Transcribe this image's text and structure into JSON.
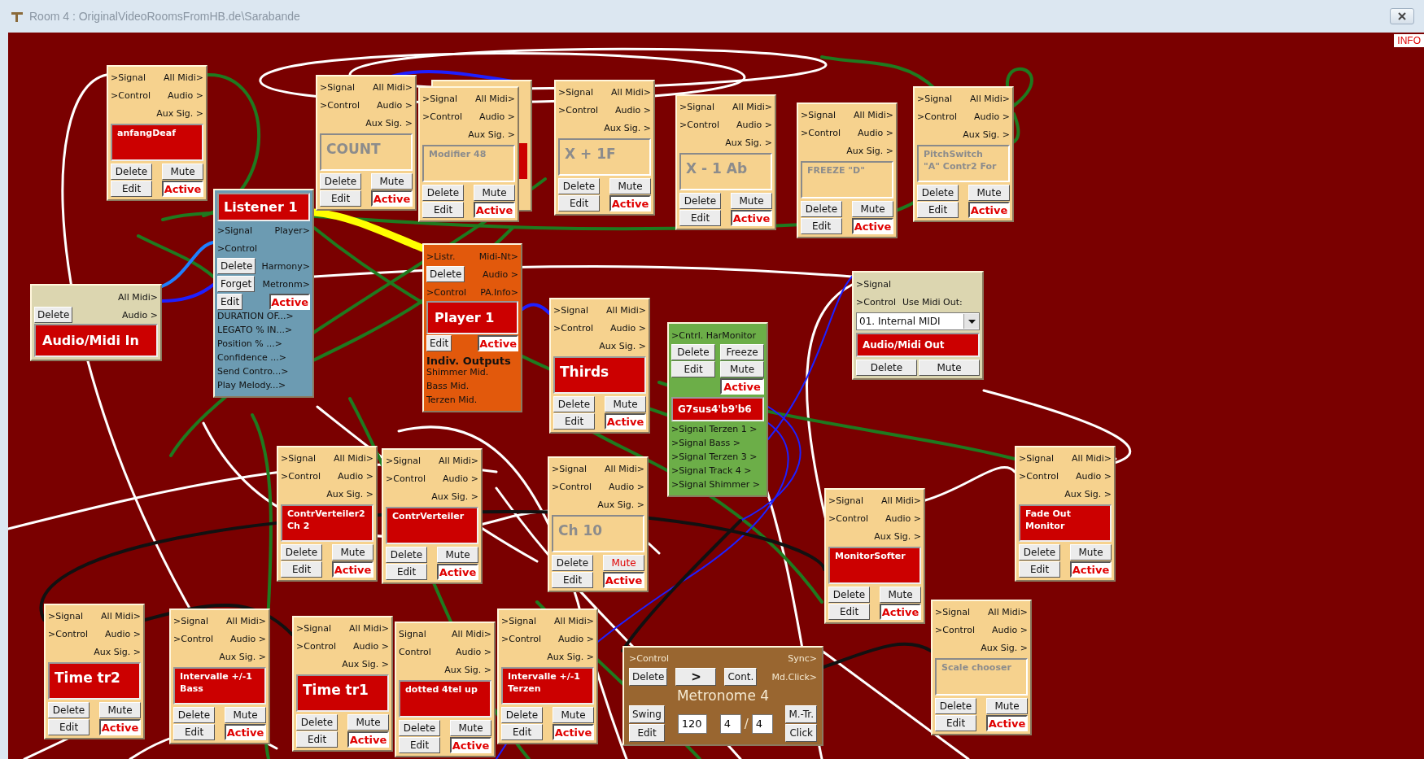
{
  "window": {
    "title": "Room 4 : OriginalVideoRoomsFromHB.de\\Sarabande",
    "info": "INFO"
  },
  "nodes": [
    {
      "kind": "module",
      "in": [
        ">Signal",
        ">Control"
      ],
      "out": [
        "All Midi>",
        "Audio >",
        "Aux Sig. >"
      ],
      "label": [
        "anfangDeaf"
      ],
      "highlighted": true,
      "large": false,
      "buttons": [
        "Delete",
        "Edit",
        "Mute"
      ],
      "status": "Active",
      "muted": false
    },
    {
      "kind": "module",
      "in": [
        ">Signal",
        ">Control"
      ],
      "out": [
        "All Midi>",
        "Audio >",
        "Aux Sig. >"
      ],
      "label": [
        "COUNT"
      ],
      "highlighted": false,
      "large": true,
      "buttons": [
        "Delete",
        "Edit",
        "Mute"
      ],
      "status": "Active",
      "muted": false
    },
    {
      "kind": "module",
      "in": [
        ">Signal",
        ">Control"
      ],
      "out": [
        "All Midi>",
        "Audio >",
        "Aux Sig. >"
      ],
      "label": [
        "Modifier 48"
      ],
      "highlighted": false,
      "large": false,
      "buttons": [
        "Delete",
        "Edit",
        "Mute"
      ],
      "status": "Active",
      "muted": false
    },
    {
      "kind": "module",
      "in": [
        ">Signal",
        ">Control"
      ],
      "out": [
        "All Midi>",
        "Audio >",
        "Aux Sig. >"
      ],
      "label": [
        "X + 1F"
      ],
      "highlighted": false,
      "large": true,
      "buttons": [
        "Delete",
        "Edit",
        "Mute"
      ],
      "status": "Active",
      "muted": false
    },
    {
      "kind": "module",
      "in": [
        ">Signal",
        ">Control"
      ],
      "out": [
        "All Midi>",
        "Audio >",
        "Aux Sig. >"
      ],
      "label": [
        "X - 1 Ab"
      ],
      "highlighted": false,
      "large": true,
      "buttons": [
        "Delete",
        "Edit",
        "Mute"
      ],
      "status": "Active",
      "muted": false
    },
    {
      "kind": "module",
      "in": [
        ">Signal",
        ">Control"
      ],
      "out": [
        "All Midi>",
        "Audio >",
        "Aux Sig. >"
      ],
      "label": [
        "FREEZE \"D\""
      ],
      "highlighted": false,
      "large": false,
      "buttons": [
        "Delete",
        "Edit",
        "Mute"
      ],
      "status": "Active",
      "muted": false
    },
    {
      "kind": "module",
      "in": [
        ">Signal",
        ">Control"
      ],
      "out": [
        "All Midi>",
        "Audio >",
        "Aux Sig. >"
      ],
      "label": [
        "PitchSwitch",
        "\"A\" Contr2 For"
      ],
      "highlighted": false,
      "large": false,
      "buttons": [
        "Delete",
        "Edit",
        "Mute"
      ],
      "status": "Active",
      "muted": false
    },
    {
      "kind": "listener",
      "title": "Listener 1",
      "in": [
        ">Signal",
        ">Control"
      ],
      "out": [
        "Player>",
        "Harmony>",
        "Metronm>"
      ],
      "buttons": [
        "Delete",
        "Forget",
        "Edit"
      ],
      "status": "Active",
      "items": [
        "DURATION OF...>",
        "LEGATO % IN...>",
        "Position % ...>",
        "Confidence ...>",
        "Send Contro...>",
        "Play Melody...>"
      ]
    },
    {
      "kind": "audio_in",
      "out": [
        "All Midi>",
        "Audio >"
      ],
      "buttons": [
        "Delete"
      ],
      "label": "Audio/Midi In"
    },
    {
      "kind": "player",
      "in": [
        ">Listr.",
        ">Control"
      ],
      "out": [
        "Midi-Nt>",
        "Audio >",
        "PA.Info>"
      ],
      "buttons": [
        "Delete",
        "Edit"
      ],
      "status": "Active",
      "label": "Player 1",
      "heading": "Indiv. Outputs",
      "items": [
        "Shimmer Mid.",
        "Bass Mid.",
        "Terzen Mid."
      ]
    },
    {
      "kind": "module",
      "in": [
        ">Signal",
        ">Control"
      ],
      "out": [
        "All Midi>",
        "Audio >",
        "Aux Sig. >"
      ],
      "label": [
        "Thirds"
      ],
      "highlighted": true,
      "large": true,
      "buttons": [
        "Delete",
        "Edit",
        "Mute"
      ],
      "status": "Active",
      "muted": false
    },
    {
      "kind": "harmonitor",
      "in": ">Cntrl. HarMonitor",
      "buttons": [
        "Delete",
        "Freeze",
        "Edit",
        "Mute"
      ],
      "status": "Active",
      "label": "G7sus4'b9'b6",
      "out": [
        ">Signal Terzen 1 >",
        ">Signal Bass >",
        ">Signal Terzen 3 >",
        ">Signal Track 4 >",
        ">Signal Shimmer >"
      ]
    },
    {
      "kind": "audio_out",
      "in": [
        ">Signal",
        ">Control"
      ],
      "caption": "Use Midi Out:",
      "select": "01. Internal MIDI",
      "label": "Audio/Midi Out",
      "buttons": [
        "Delete",
        "Mute"
      ]
    },
    {
      "kind": "module",
      "in": [
        ">Signal",
        ">Control"
      ],
      "out": [
        "All Midi>",
        "Audio >",
        "Aux Sig. >"
      ],
      "label": [
        "ContrVerteiler2",
        "Ch 2"
      ],
      "highlighted": true,
      "large": false,
      "buttons": [
        "Delete",
        "Edit",
        "Mute"
      ],
      "status": "Active",
      "muted": false
    },
    {
      "kind": "module",
      "in": [
        ">Signal",
        ">Control"
      ],
      "out": [
        "All Midi>",
        "Audio >",
        "Aux Sig. >"
      ],
      "label": [
        "ContrVerteiler"
      ],
      "highlighted": true,
      "large": false,
      "buttons": [
        "Delete",
        "Edit",
        "Mute"
      ],
      "status": "Active",
      "muted": false
    },
    {
      "kind": "module",
      "in": [
        ">Signal",
        ">Control"
      ],
      "out": [
        "All Midi>",
        "Audio >",
        "Aux Sig. >"
      ],
      "label": [
        "Ch 10"
      ],
      "highlighted": false,
      "large": true,
      "buttons": [
        "Delete",
        "Edit",
        "Mute"
      ],
      "status": "Active",
      "muted": true
    },
    {
      "kind": "module",
      "in": [
        ">Signal",
        ">Control"
      ],
      "out": [
        "All Midi>",
        "Audio >",
        "Aux Sig. >"
      ],
      "label": [
        "MonitorSofter"
      ],
      "highlighted": true,
      "large": false,
      "buttons": [
        "Delete",
        "Edit",
        "Mute"
      ],
      "status": "Active",
      "muted": false
    },
    {
      "kind": "module",
      "in": [
        ">Signal",
        ">Control"
      ],
      "out": [
        "All Midi>",
        "Audio >",
        "Aux Sig. >"
      ],
      "label": [
        "Fade Out",
        "Monitor"
      ],
      "highlighted": true,
      "large": false,
      "buttons": [
        "Delete",
        "Edit",
        "Mute"
      ],
      "status": "Active",
      "muted": false
    },
    {
      "kind": "module",
      "in": [
        ">Signal",
        ">Control"
      ],
      "out": [
        "All Midi>",
        "Audio >",
        "Aux Sig. >"
      ],
      "label": [
        "Time tr2"
      ],
      "highlighted": true,
      "large": true,
      "buttons": [
        "Delete",
        "Edit",
        "Mute"
      ],
      "status": "Active",
      "muted": false
    },
    {
      "kind": "module",
      "in": [
        ">Signal",
        ">Control"
      ],
      "out": [
        "All Midi>",
        "Audio >",
        "Aux Sig. >"
      ],
      "label": [
        "Intervalle +/-1",
        "Bass"
      ],
      "highlighted": true,
      "large": false,
      "buttons": [
        "Delete",
        "Edit",
        "Mute"
      ],
      "status": "Active",
      "muted": false
    },
    {
      "kind": "module",
      "in": [
        ">Signal",
        ">Control"
      ],
      "out": [
        "All Midi>",
        "Audio >",
        "Aux Sig. >"
      ],
      "label": [
        "Time tr1"
      ],
      "highlighted": true,
      "large": true,
      "buttons": [
        "Delete",
        "Edit",
        "Mute"
      ],
      "status": "Active",
      "muted": false
    },
    {
      "kind": "module",
      "in": [
        "Signal",
        "Control"
      ],
      "out": [
        "All Midi>",
        "Audio >",
        "Aux Sig. >"
      ],
      "label": [
        "dotted 4tel up"
      ],
      "highlighted": true,
      "large": false,
      "buttons": [
        "Delete",
        "Edit",
        "Mute"
      ],
      "status": "Active",
      "muted": false
    },
    {
      "kind": "module",
      "in": [
        ">Signal",
        ">Control"
      ],
      "out": [
        "All Midi>",
        "Audio >",
        "Aux Sig. >"
      ],
      "label": [
        "Intervalle +/-1",
        "Terzen"
      ],
      "highlighted": true,
      "large": false,
      "buttons": [
        "Delete",
        "Edit",
        "Mute"
      ],
      "status": "Active",
      "muted": false
    },
    {
      "kind": "metronome",
      "in": ">Control",
      "out": [
        "Sync>",
        "Md.Click>"
      ],
      "buttons": [
        "Delete",
        ">",
        "Cont.",
        "Swing",
        "Edit",
        "M.-Tr.",
        "Click"
      ],
      "title": "Metronome 4",
      "tempo": "120",
      "beats": "4",
      "separator": "/",
      "unit": "4"
    },
    {
      "kind": "module",
      "in": [
        ">Signal",
        ">Control"
      ],
      "out": [
        "All Midi>",
        "Audio >",
        "Aux Sig. >"
      ],
      "label": [
        "Scale chooser"
      ],
      "highlighted": false,
      "large": false,
      "buttons": [
        "Delete",
        "Edit",
        "Mute"
      ],
      "status": "Active",
      "muted": false
    }
  ]
}
